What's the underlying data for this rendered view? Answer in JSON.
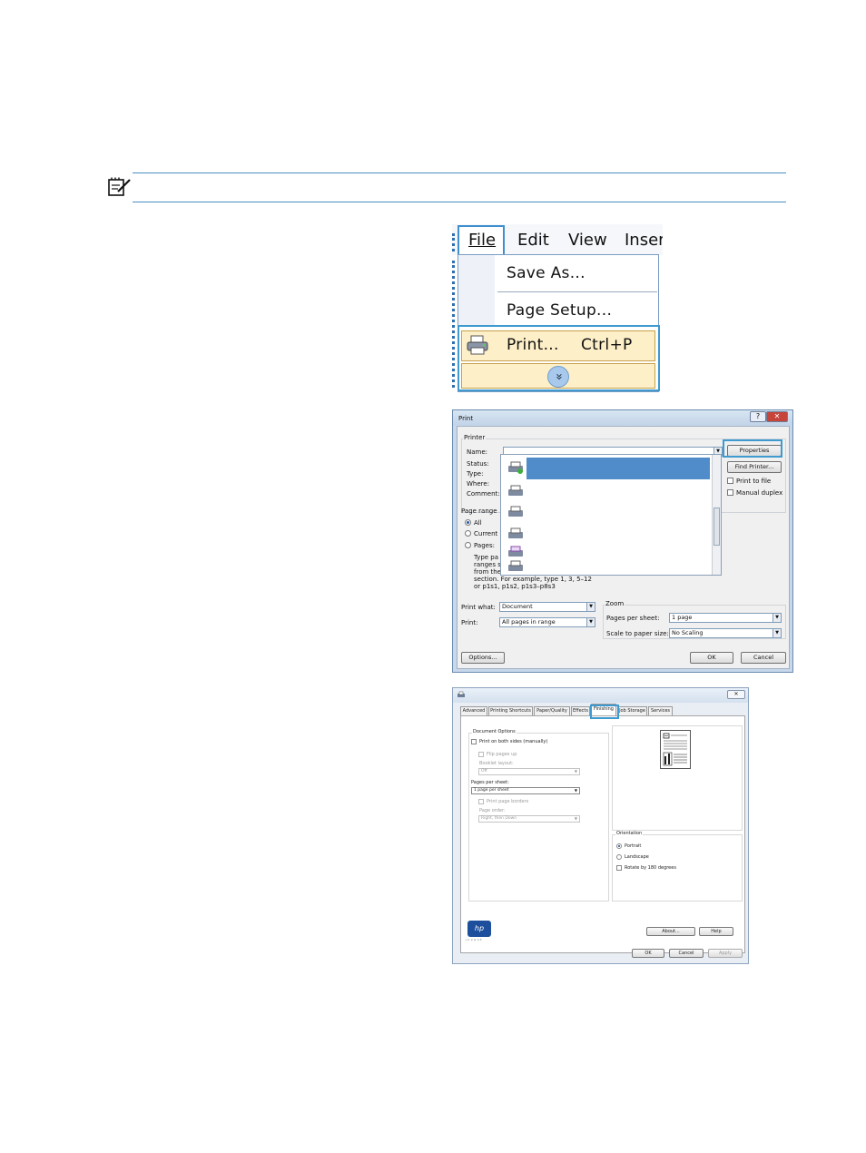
{
  "file_menu": {
    "menubar": [
      "File",
      "Edit",
      "View",
      "Inser"
    ],
    "items": [
      "Save As...",
      "Page Setup...",
      "Print..."
    ],
    "print_shortcut": "Ctrl+P",
    "expand_glyph": "»"
  },
  "print_dialog": {
    "title": "Print",
    "help_glyph": "?",
    "close_glyph": "✕",
    "printer_group": "Printer",
    "name_label": "Name:",
    "status_label": "Status:",
    "type_label": "Type:",
    "where_label": "Where:",
    "comment_label": "Comment:",
    "properties_button": "Properties",
    "find_printer_button": "Find Printer...",
    "print_to_file": "Print to file",
    "manual_duplex": "Manual duplex",
    "page_range_group": "Page range",
    "range_all": "All",
    "range_current": "Current",
    "range_pages": "Pages:",
    "range_help_lines": [
      "Type pa",
      "ranges s",
      "from the",
      "section. For example, type 1, 3, 5–12",
      "or p1s1, p1s2, p1s3–p8s3"
    ],
    "print_what_label": "Print what:",
    "print_what_value": "Document",
    "print_label": "Print:",
    "print_value": "All pages in range",
    "zoom_group": "Zoom",
    "pages_per_sheet_label": "Pages per sheet:",
    "pages_per_sheet_value": "1 page",
    "scale_label": "Scale to paper size:",
    "scale_value": "No Scaling",
    "options_button": "Options...",
    "ok_button": "OK",
    "cancel_button": "Cancel"
  },
  "properties_dialog": {
    "close_glyph": "✕",
    "tabs": [
      "Advanced",
      "Printing Shortcuts",
      "Paper/Quality",
      "Effects",
      "Finishing",
      "Job Storage",
      "Services"
    ],
    "active_tab": "Finishing",
    "document_options_group": "Document Options",
    "print_both_sides": "Print on both sides (manually)",
    "flip_pages_up": "Flip pages up",
    "booklet_layout_label": "Booklet layout:",
    "booklet_layout_value": "Off",
    "pages_per_sheet_label": "Pages per sheet:",
    "pages_per_sheet_value": "1 page per sheet",
    "print_page_borders": "Print page borders",
    "page_order_label": "Page order:",
    "page_order_value": "Right, then Down",
    "orientation_group": "Orientation",
    "portrait": "Portrait",
    "landscape": "Landscape",
    "rotate": "Rotate by 180 degrees",
    "about_button": "About...",
    "help_button": "Help",
    "ok_button": "OK",
    "cancel_button": "Cancel",
    "apply_button": "Apply",
    "logo_text": "hp",
    "logo_sub": "invent"
  }
}
